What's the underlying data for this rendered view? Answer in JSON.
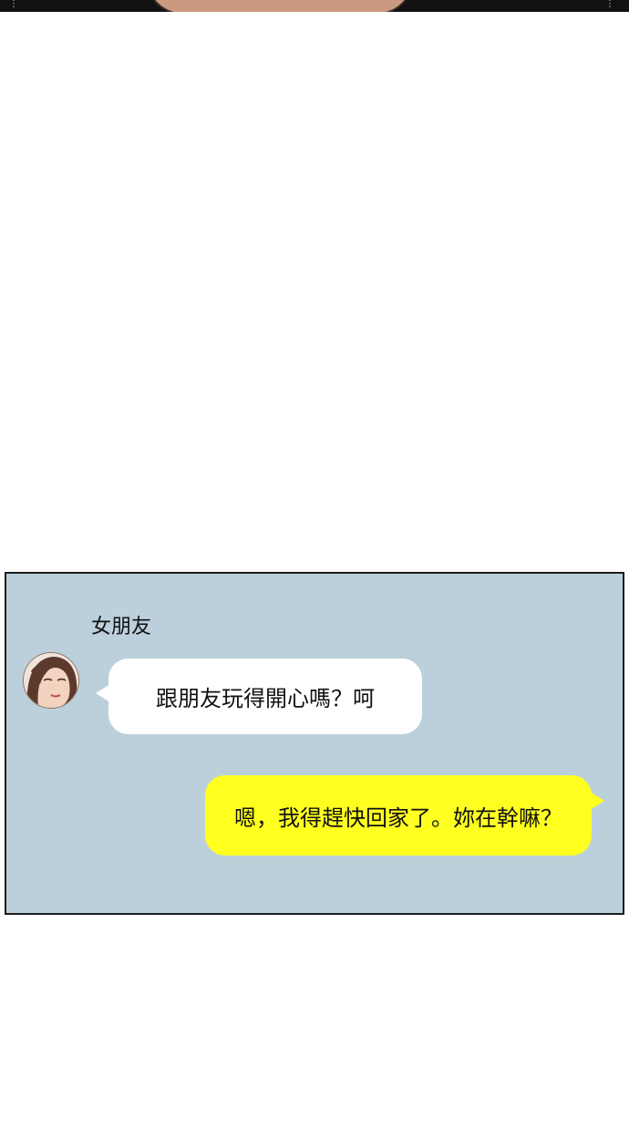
{
  "chat": {
    "sender_name": "女朋友",
    "messages": [
      {
        "direction": "incoming",
        "text": "跟朋友玩得開心嗎？呵"
      },
      {
        "direction": "outgoing",
        "text": "嗯，我得趕快回家了。妳在幹嘛？"
      }
    ]
  },
  "colors": {
    "panel_background": "#bcd0dc",
    "incoming_bubble": "#ffffff",
    "outgoing_bubble": "#ffff20"
  },
  "icons": {
    "avatar": "girlfriend-avatar"
  }
}
